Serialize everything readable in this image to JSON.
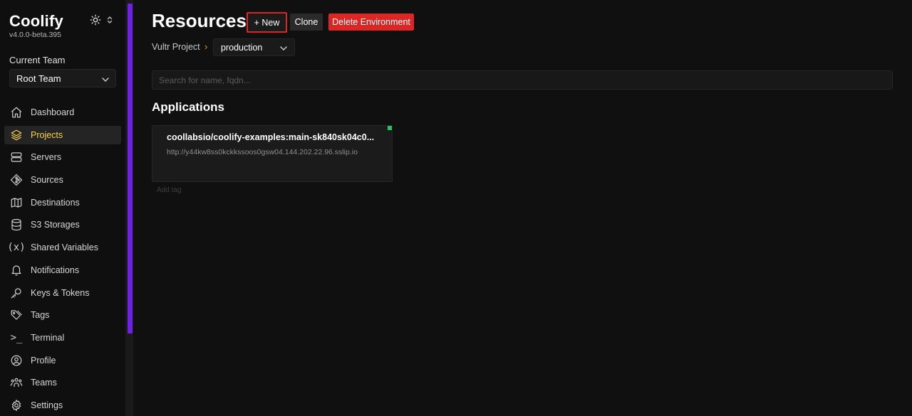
{
  "app": {
    "name": "Coolify",
    "version": "v4.0.0-beta.395"
  },
  "theme_toggle": {
    "icon": "sun-icon"
  },
  "team": {
    "label": "Current Team",
    "selected": "Root Team"
  },
  "sidebar": {
    "items": [
      {
        "label": "Dashboard",
        "icon": "home-icon",
        "active": false
      },
      {
        "label": "Projects",
        "icon": "layers-icon",
        "active": true
      },
      {
        "label": "Servers",
        "icon": "server-icon",
        "active": false
      },
      {
        "label": "Sources",
        "icon": "git-icon",
        "active": false
      },
      {
        "label": "Destinations",
        "icon": "map-icon",
        "active": false
      },
      {
        "label": "S3 Storages",
        "icon": "database-icon",
        "active": false
      },
      {
        "label": "Shared Variables",
        "icon": "variable-icon",
        "active": false
      },
      {
        "label": "Notifications",
        "icon": "bell-icon",
        "active": false
      },
      {
        "label": "Keys & Tokens",
        "icon": "key-icon",
        "active": false
      },
      {
        "label": "Tags",
        "icon": "tags-icon",
        "active": false
      },
      {
        "label": "Terminal",
        "icon": "terminal-icon",
        "active": false
      },
      {
        "label": "Profile",
        "icon": "user-circle-icon",
        "active": false
      },
      {
        "label": "Teams",
        "icon": "users-icon",
        "active": false
      },
      {
        "label": "Settings",
        "icon": "gear-icon",
        "active": false
      }
    ],
    "variables_glyph": "(x)",
    "terminal_glyph": ">_"
  },
  "page": {
    "title": "Resources",
    "new_label": "+ New",
    "clone_label": "Clone",
    "delete_label": "Delete Environment"
  },
  "breadcrumb": {
    "project": "Vultr Project",
    "separator": "›",
    "environment": "production"
  },
  "search": {
    "placeholder": "Search for name, fqdn...",
    "value": ""
  },
  "applications": {
    "heading": "Applications",
    "items": [
      {
        "name": "coollabsio/coolify-examples:main-sk840sk04c0...",
        "url": "http://y44kw8ss0kckkssoos0gsw04.144.202.22.96.sslip.io",
        "status_color": "#22c55e",
        "add_tag_label": "Add tag"
      }
    ]
  },
  "colors": {
    "accent": "#6b21e8",
    "active_nav": "#fcd34d",
    "danger": "#dc2626",
    "running": "#22c55e"
  }
}
